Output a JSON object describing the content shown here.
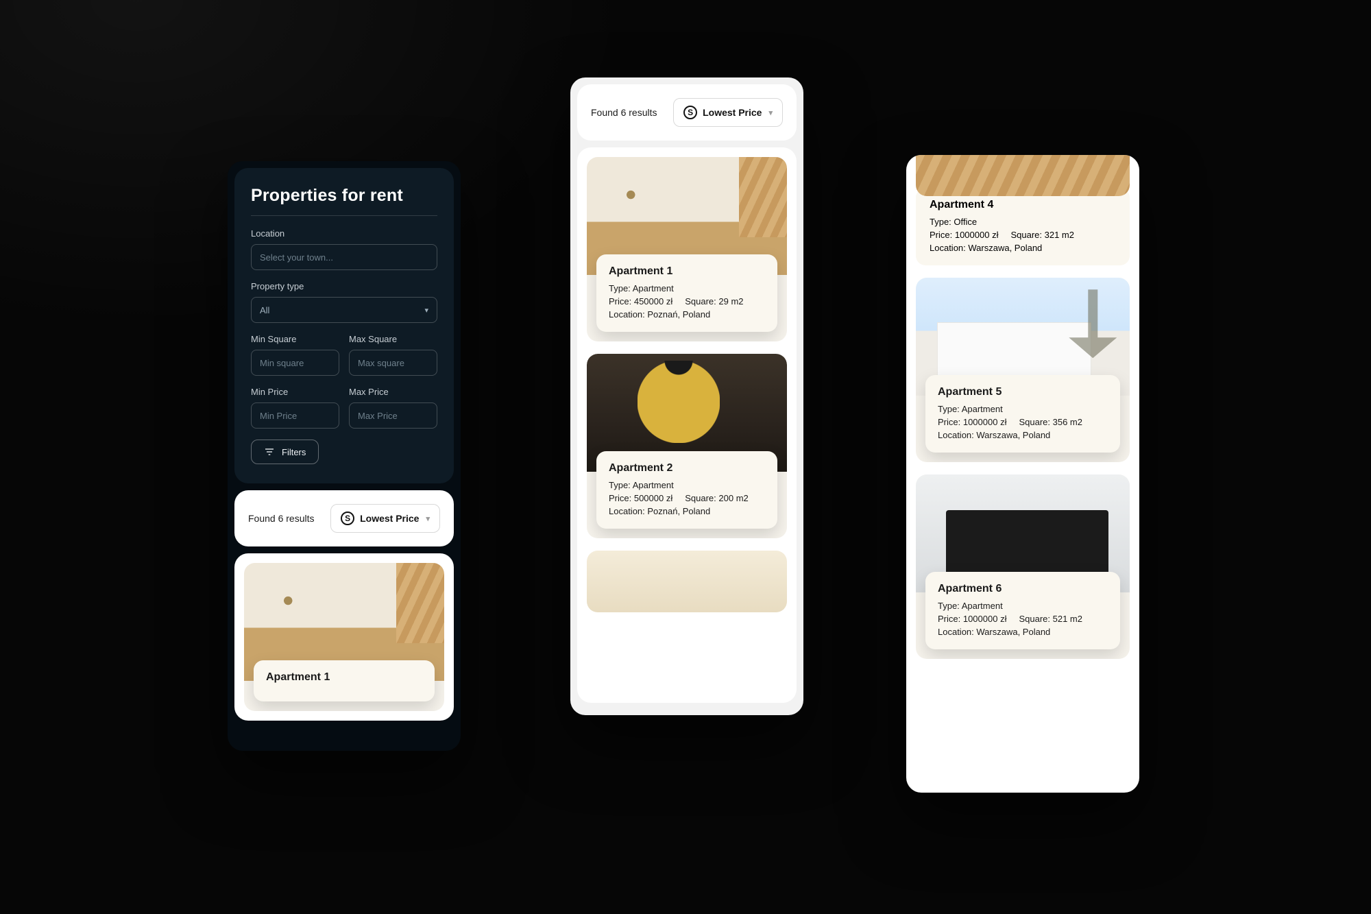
{
  "filter": {
    "title": "Properties for rent",
    "location_label": "Location",
    "location_placeholder": "Select your town...",
    "property_type_label": "Property type",
    "property_type_value": "All",
    "min_square_label": "Min Square",
    "min_square_placeholder": "Min square",
    "max_square_label": "Max Square",
    "max_square_placeholder": "Max square",
    "min_price_label": "Min Price",
    "min_price_placeholder": "Min Price",
    "max_price_label": "Max Price",
    "max_price_placeholder": "Max Price",
    "filters_button": "Filters"
  },
  "results": {
    "count_text": "Found 6 results",
    "sort_label": "Lowest Price"
  },
  "labels": {
    "type": "Type: ",
    "price": "Price: ",
    "square": "Square: ",
    "location": "Location: "
  },
  "listings": [
    {
      "name": "Apartment 1",
      "type": "Apartment",
      "price": "450000 zł",
      "square": "29 m2",
      "location": "Poznań, Poland"
    },
    {
      "name": "Apartment 2",
      "type": "Apartment",
      "price": "500000 zł",
      "square": "200 m2",
      "location": "Poznań, Poland"
    },
    {
      "name": "Apartment 4",
      "type": "Office",
      "price": "1000000 zł",
      "square": "321 m2",
      "location": "Warszawa, Poland"
    },
    {
      "name": "Apartment 5",
      "type": "Apartment",
      "price": "1000000 zł",
      "square": "356 m2",
      "location": "Warszawa, Poland"
    },
    {
      "name": "Apartment 6",
      "type": "Apartment",
      "price": "1000000 zł",
      "square": "521 m2",
      "location": "Warszawa, Poland"
    }
  ]
}
